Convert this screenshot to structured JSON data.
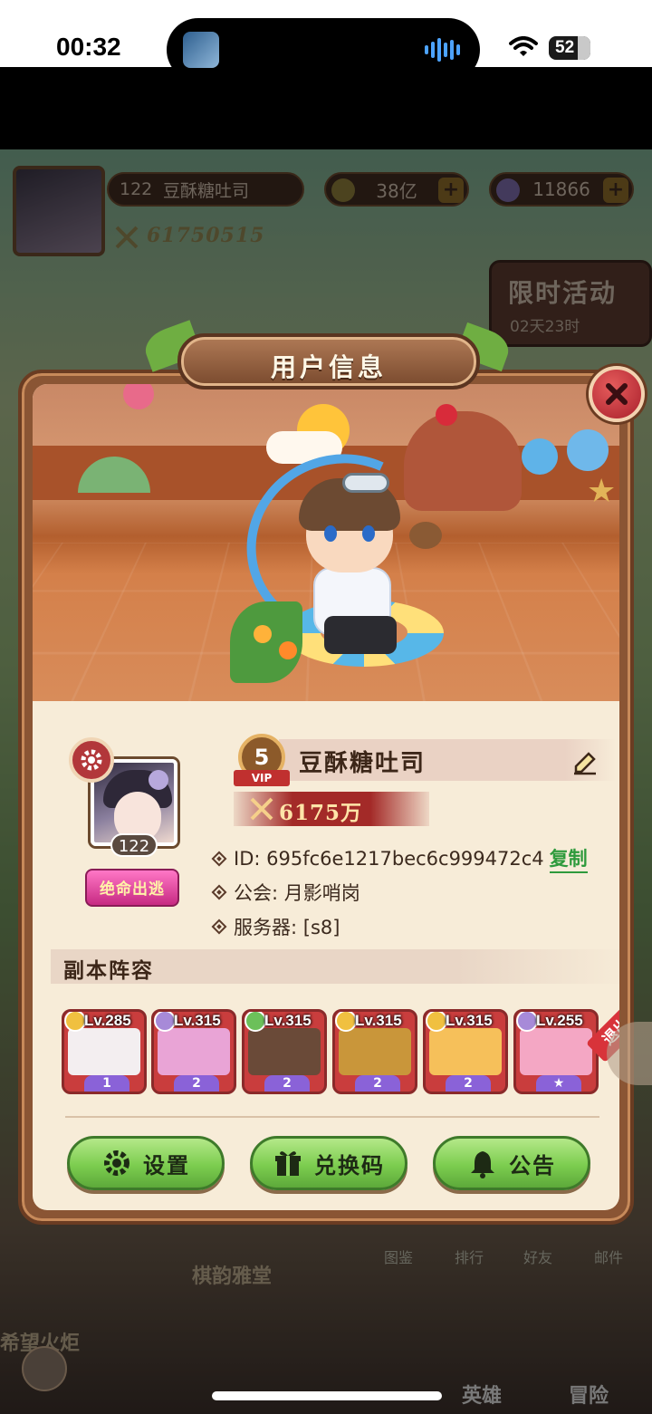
{
  "status_bar": {
    "time": "00:32",
    "battery": "52"
  },
  "hud": {
    "player_level": "122",
    "player_name": "豆酥糖吐司",
    "combat_power": "61750515",
    "gold": "38亿",
    "diamonds": "11866",
    "limited_event_title": "限时活动",
    "limited_event_time": "02天23时",
    "bottom_menu": [
      "图鉴",
      "排行",
      "好友",
      "邮件"
    ],
    "building_label": "棋韵雅堂",
    "area_label": "希望火炬",
    "nav_hero": "英雄",
    "nav_adventure": "冒险"
  },
  "modal": {
    "title": "用户信息",
    "avatar_level": "122",
    "title_badge": "绝命出逃",
    "vip_level": "5",
    "vip_label": "VIP",
    "name": "豆酥糖吐司",
    "power": "6175万",
    "id_line": "ID: 695fc6e1217bec6c999472c4",
    "copy_label": "复制",
    "guild_line": "公会: 月影哨岗",
    "server_line": "服务器: [s8]",
    "lineup_title": "副本阵容",
    "lineup": [
      {
        "level": "Lv.285",
        "star": "1",
        "element_color": "#f0c040",
        "art_color": "#f3eef0",
        "star_color": "#8a62d8"
      },
      {
        "level": "Lv.315",
        "star": "2",
        "element_color": "#a78ad8",
        "art_color": "#e9a4d6",
        "star_color": "#8a62d8"
      },
      {
        "level": "Lv.315",
        "star": "2",
        "element_color": "#6cc05a",
        "art_color": "#6a4a38",
        "star_color": "#8a62d8"
      },
      {
        "level": "Lv.315",
        "star": "2",
        "element_color": "#f0c040",
        "art_color": "#c9963a",
        "star_color": "#8a62d8"
      },
      {
        "level": "Lv.315",
        "star": "2",
        "element_color": "#f0c040",
        "art_color": "#f6c05a",
        "star_color": "#8a62d8"
      },
      {
        "level": "Lv.255",
        "star": "★",
        "element_color": "#a78ad8",
        "art_color": "#f4a7c4",
        "star_color": "#8a62d8"
      }
    ],
    "withdraw_label": "退出",
    "buttons": {
      "settings": "设置",
      "redeem": "兑换码",
      "notice": "公告"
    }
  }
}
